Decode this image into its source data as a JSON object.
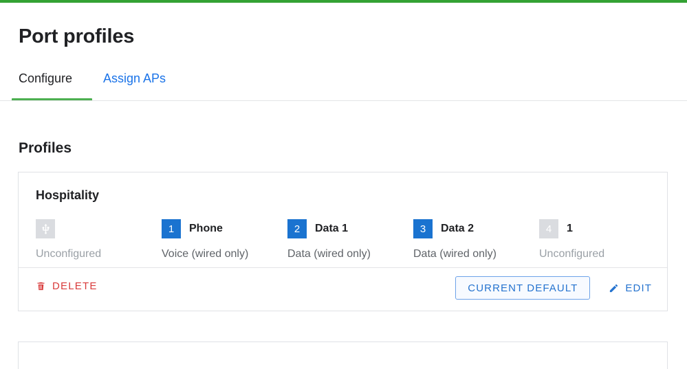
{
  "theme": {
    "accent_green": "#34a234",
    "tab_active_underline": "#4caf50",
    "link_blue": "#1a73e8",
    "badge_blue": "#1a73d0",
    "badge_gray": "#dadce0",
    "delete_red": "#d93b3b",
    "button_blue": "#2573cf",
    "border_gray": "#dfe1e5"
  },
  "header": {
    "title": "Port profiles"
  },
  "tabs": [
    {
      "label": "Configure",
      "active": true
    },
    {
      "label": "Assign APs",
      "active": false
    }
  ],
  "section": {
    "title": "Profiles"
  },
  "profile_card": {
    "name": "Hospitality",
    "ports": [
      {
        "badge": "",
        "badge_icon": "usb-icon",
        "badge_state": "inactive",
        "label": "",
        "description": "Unconfigured",
        "description_state": "muted"
      },
      {
        "badge": "1",
        "badge_icon": "",
        "badge_state": "active",
        "label": "Phone",
        "description": "Voice (wired only)",
        "description_state": "normal"
      },
      {
        "badge": "2",
        "badge_icon": "",
        "badge_state": "active",
        "label": "Data 1",
        "description": "Data (wired only)",
        "description_state": "normal"
      },
      {
        "badge": "3",
        "badge_icon": "",
        "badge_state": "active",
        "label": "Data 2",
        "description": "Data (wired only)",
        "description_state": "normal"
      },
      {
        "badge": "4",
        "badge_icon": "",
        "badge_state": "inactive",
        "label": "1",
        "description": "Unconfigured",
        "description_state": "muted"
      }
    ],
    "footer": {
      "delete_label": "DELETE",
      "delete_icon": "trash-icon",
      "default_label": "CURRENT DEFAULT",
      "edit_label": "EDIT",
      "edit_icon": "pencil-icon"
    }
  }
}
